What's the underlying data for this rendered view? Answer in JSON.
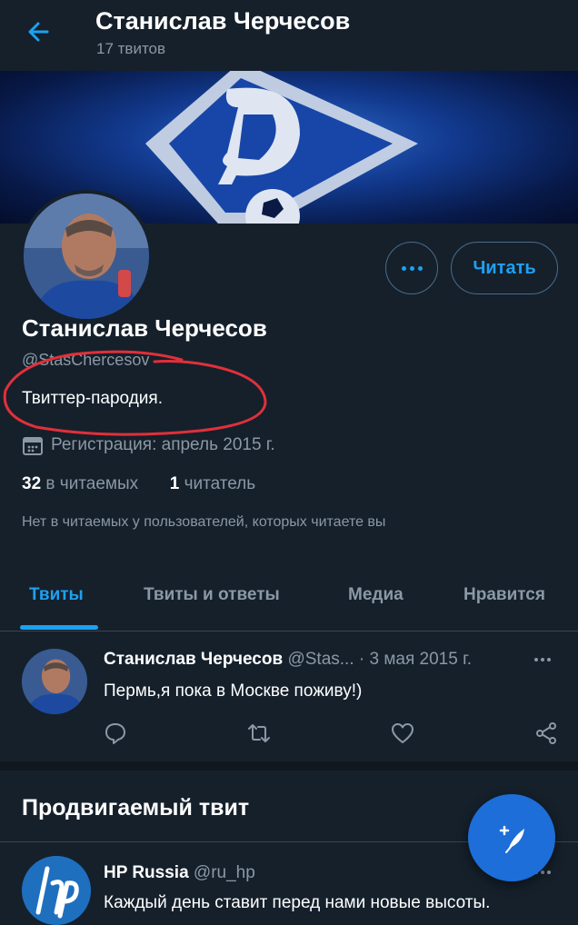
{
  "header": {
    "title": "Станислав Черчесов",
    "subtitle": "17 твитов",
    "back_icon": "arrow-left-icon"
  },
  "profile": {
    "name": "Станислав Черчесов",
    "handle": "@StasChercesov",
    "bio": "Твиттер-пародия.",
    "joined": "Регистрация: апрель 2015 г.",
    "following_count": "32",
    "following_label": "в читаемых",
    "followers_count": "1",
    "followers_label": "читатель",
    "followers_note": "Нет в читаемых у пользователей, которых читаете вы",
    "follow_button": "Читать"
  },
  "tabs": [
    {
      "label": "Твиты",
      "active": true
    },
    {
      "label": "Твиты и ответы",
      "active": false
    },
    {
      "label": "Медиа",
      "active": false
    },
    {
      "label": "Нравится",
      "active": false
    }
  ],
  "tweet": {
    "author": "Станислав Черчесов",
    "handle": "@Stas...",
    "date": "· 3 мая 2015 г.",
    "text": "Пермь,я пока в Москве поживу!)"
  },
  "promoted": {
    "title": "Продвигаемый твит",
    "author": "HP Russia",
    "handle": "@ru_hp",
    "text": "Каждый день ставит перед нами новые высоты."
  },
  "colors": {
    "background": "#15202b",
    "accent": "#1da1f2",
    "secondary_text": "#8b98a5",
    "annotation": "#e0303a"
  }
}
